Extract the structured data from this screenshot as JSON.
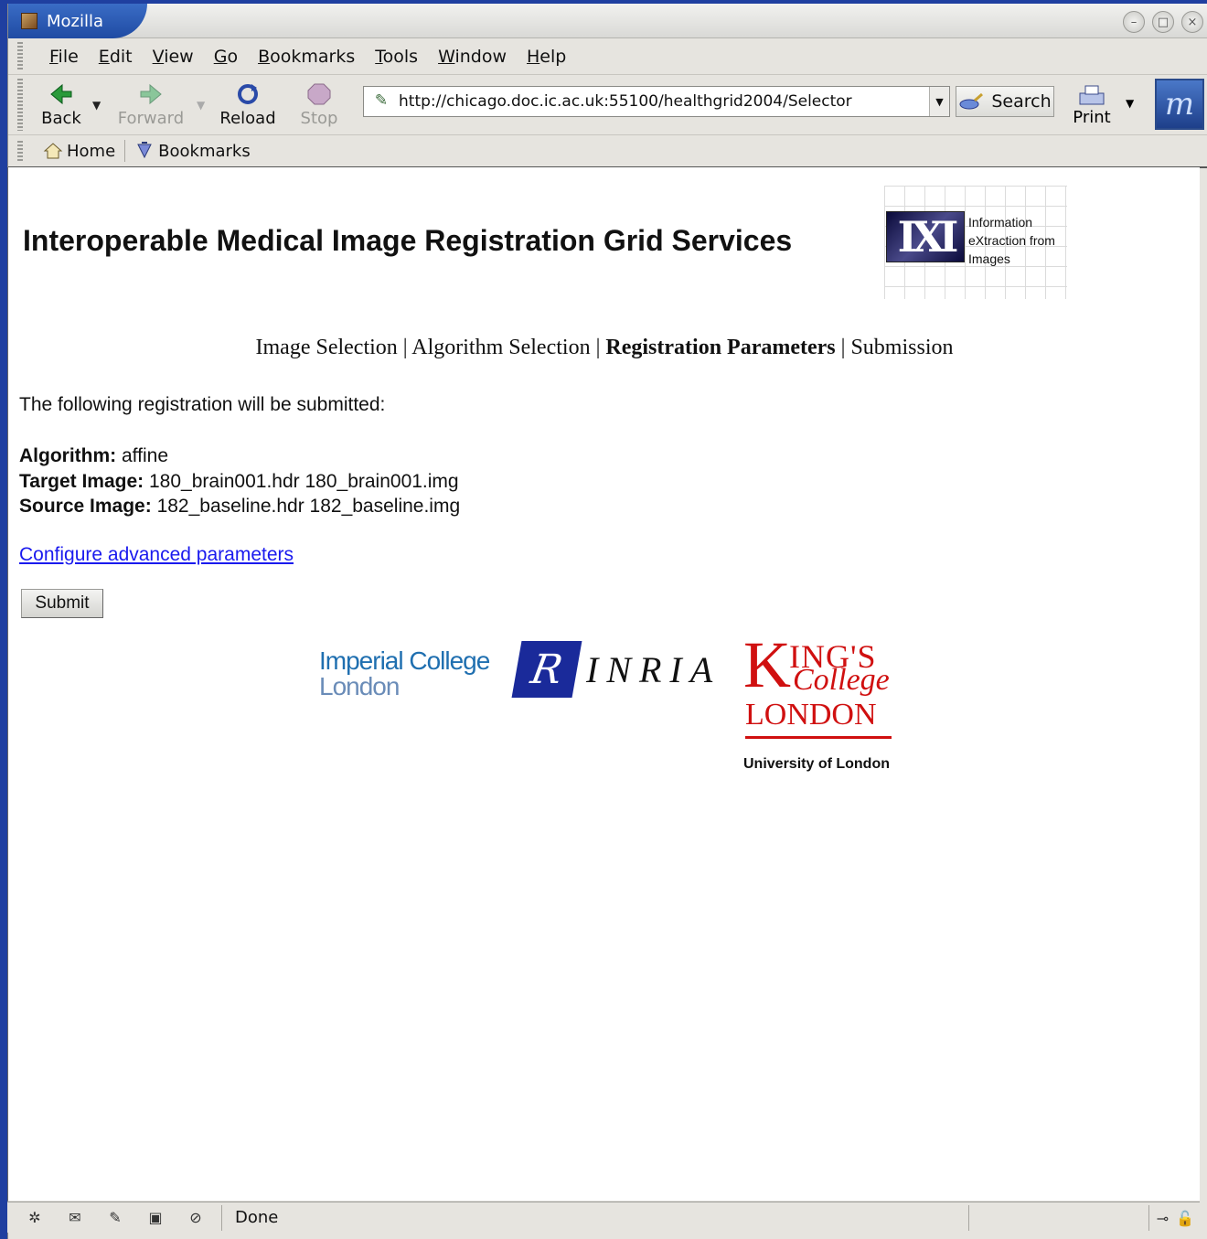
{
  "window": {
    "title": "Mozilla"
  },
  "menubar": {
    "items": [
      {
        "label": "File",
        "key": "F",
        "rest": "ile"
      },
      {
        "label": "Edit",
        "key": "E",
        "rest": "dit"
      },
      {
        "label": "View",
        "key": "V",
        "rest": "iew"
      },
      {
        "label": "Go",
        "key": "G",
        "rest": "o"
      },
      {
        "label": "Bookmarks",
        "key": "B",
        "rest": "ookmarks"
      },
      {
        "label": "Tools",
        "key": "T",
        "rest": "ools"
      },
      {
        "label": "Window",
        "key": "W",
        "rest": "indow"
      },
      {
        "label": "Help",
        "key": "H",
        "rest": "elp"
      }
    ]
  },
  "navbar": {
    "back_label": "Back",
    "forward_label": "Forward",
    "reload_label": "Reload",
    "stop_label": "Stop",
    "url": "http://chicago.doc.ic.ac.uk:55100/healthgrid2004/Selector",
    "search_label": "Search",
    "print_label": "Print"
  },
  "personal_toolbar": {
    "home_label": "Home",
    "bookmarks_label": "Bookmarks"
  },
  "page": {
    "title": "Interoperable Medical Image Registration Grid Services",
    "ixi_logo": {
      "line1": "Information",
      "line2": "eXtraction from",
      "line3": "Images"
    },
    "steps": {
      "step1": "Image Selection",
      "step2": "Algorithm Selection",
      "step3": "Registration Parameters",
      "step4": "Submission",
      "separator": " | "
    },
    "intro": "The following registration will be submitted:",
    "algorithm_label": "Algorithm:",
    "algorithm_value": "affine",
    "target_label": "Target Image:",
    "target_value": "180_brain001.hdr 180_brain001.img",
    "source_label": "Source Image:",
    "source_value": "182_baseline.hdr 182_baseline.img",
    "advanced_link": "Configure advanced parameters",
    "submit_label": "Submit",
    "logos": {
      "imperial_line1": "Imperial College",
      "imperial_line2": "London",
      "inria": "INRIA",
      "kings_k": "K",
      "kings_ings": "ING'S",
      "kings_college": "College",
      "kings_london": "LONDON",
      "kings_uol": "University of London"
    }
  },
  "statusbar": {
    "text": "Done"
  }
}
